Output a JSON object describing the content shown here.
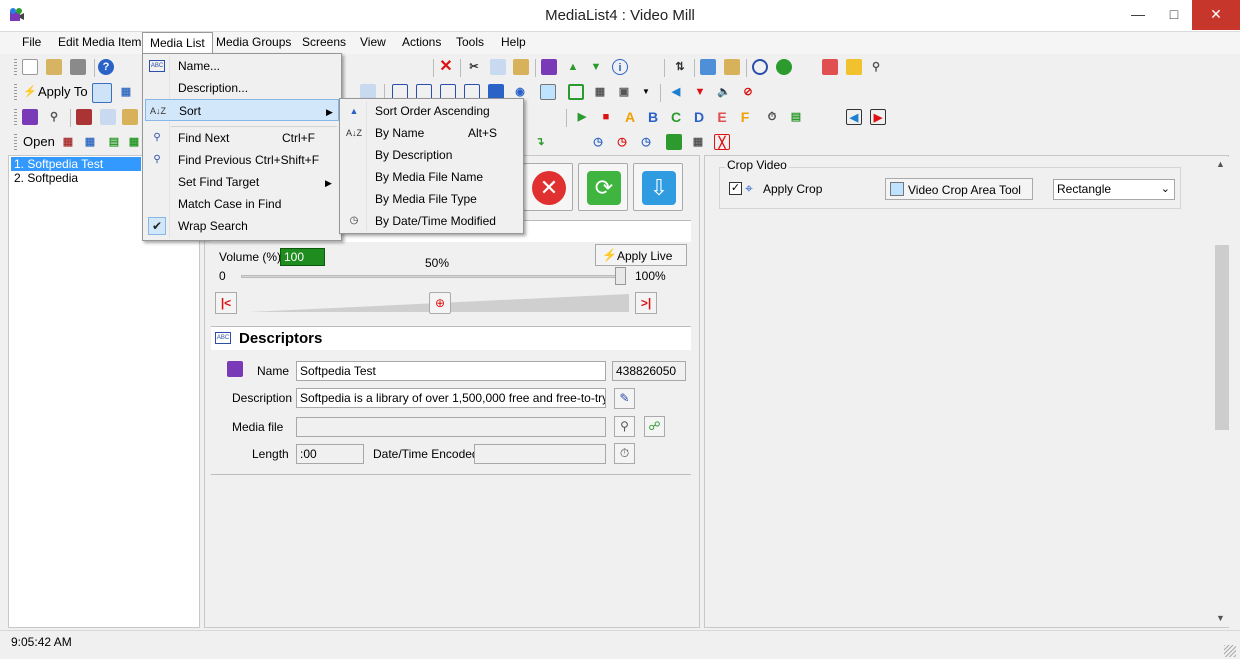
{
  "window": {
    "title": "MediaList4 : Video Mill"
  },
  "menubar": [
    "File",
    "Edit Media Item",
    "Media List",
    "Media Groups",
    "Screens",
    "View",
    "Actions",
    "Tools",
    "Help"
  ],
  "toolbar": {
    "apply_to": "Apply To",
    "open": "Open"
  },
  "media_list": [
    "1. Softpedia Test",
    "2. Softpedia"
  ],
  "media_list_menu": {
    "items": [
      {
        "label": "Name...",
        "shortcut": ""
      },
      {
        "label": "Description...",
        "shortcut": ""
      },
      {
        "label": "Sort",
        "shortcut": ""
      },
      {
        "label": "Find Next",
        "shortcut": "Ctrl+F"
      },
      {
        "label": "Find Previous",
        "shortcut": "Ctrl+Shift+F"
      },
      {
        "label": "Set Find Target",
        "shortcut": ""
      },
      {
        "label": "Match Case in Find",
        "shortcut": ""
      },
      {
        "label": "Wrap Search",
        "shortcut": ""
      }
    ]
  },
  "sort_submenu": {
    "items": [
      {
        "label": "Sort Order Ascending",
        "shortcut": ""
      },
      {
        "label": "By Name",
        "shortcut": "Alt+S"
      },
      {
        "label": "By Description",
        "shortcut": ""
      },
      {
        "label": "By Media File Name",
        "shortcut": ""
      },
      {
        "label": "By Media File Type",
        "shortcut": ""
      },
      {
        "label": "By Date/Time Modified",
        "shortcut": ""
      }
    ]
  },
  "audio": {
    "volume_label": "Volume (%)",
    "volume_value": "100",
    "mid_label": "50%",
    "min_label": "0",
    "max_label": "100%",
    "apply_live": "Apply Live"
  },
  "descriptors": {
    "heading": "Descriptors",
    "name_label": "Name",
    "name_value": "Softpedia Test",
    "id_value": "438826050",
    "description_label": "Description",
    "description_value": "Softpedia is a library of over 1,500,000 free and free-to-try",
    "media_file_label": "Media file",
    "media_file_value": "",
    "length_label": "Length",
    "length_value": ":00",
    "date_label": "Date/Time Encoded",
    "date_value": ""
  },
  "crop": {
    "group_label": "Crop Video",
    "apply_crop": "Apply Crop",
    "apply_crop_checked": true,
    "tool_button": "Video Crop Area Tool",
    "shape_value": "Rectangle"
  },
  "status": {
    "time": "9:05:42 AM"
  },
  "colors": {
    "selection": "#3399ff",
    "close": "#c7362b",
    "menu_highlight": "#d3e7fb"
  }
}
